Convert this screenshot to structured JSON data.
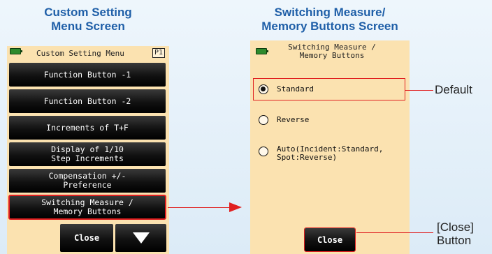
{
  "left_caption": [
    "Custom Setting",
    "Menu Screen"
  ],
  "right_caption": [
    "Switching Measure/",
    "Memory Buttons Screen"
  ],
  "left_screen": {
    "title": "Custom Setting Menu",
    "page": "P1",
    "items": [
      "Function Button -1",
      "Function Button -2",
      "Increments of T+F",
      "Display of 1/10\nStep Increments",
      "Compensation +/-\nPreference",
      "Switching Measure /\nMemory Buttons"
    ],
    "close_label": "Close"
  },
  "right_screen": {
    "title": "Switching Measure /\nMemory Buttons",
    "options": [
      {
        "label": "Standard",
        "checked": true
      },
      {
        "label": "Reverse",
        "checked": false
      },
      {
        "label": "Auto(Incident:Standard,\nSpot:Reverse)",
        "checked": false
      }
    ],
    "close_label": "Close"
  },
  "annotations": {
    "default_label": "Default",
    "close_label_line1": "[Close]",
    "close_label_line2": "Button"
  },
  "colors": {
    "accent": "#e02020",
    "caption": "#1f5fa8",
    "screen_bg": "#fbe2b0"
  }
}
